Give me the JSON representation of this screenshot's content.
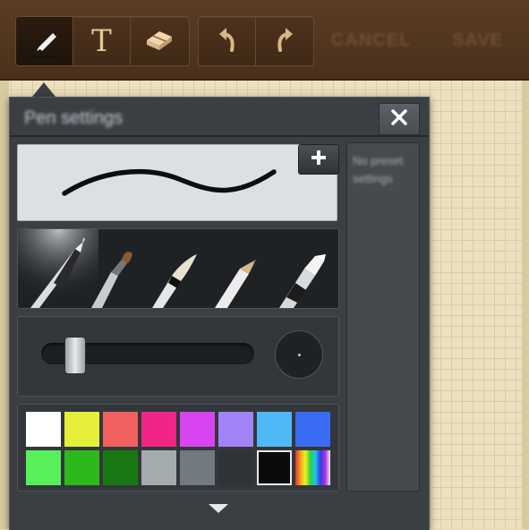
{
  "toolbar": {
    "tools": [
      {
        "name": "pen-tool",
        "icon": "pen-icon",
        "active": true
      },
      {
        "name": "text-tool",
        "icon": "text-icon",
        "glyph": "T",
        "active": false
      },
      {
        "name": "eraser-tool",
        "icon": "eraser-icon",
        "active": false
      }
    ],
    "history": [
      {
        "name": "undo-button",
        "icon": "undo-icon"
      },
      {
        "name": "redo-button",
        "icon": "redo-icon"
      }
    ],
    "cancel_label": "CANCEL",
    "save_label": "SAVE"
  },
  "panel": {
    "title": "Pen settings",
    "close_icon": "close-icon",
    "add_icon": "plus-icon",
    "preset_text": "No preset settings",
    "pens": [
      "marker-pen",
      "brush-pen",
      "calligraphy-brush",
      "pencil",
      "highlighter"
    ],
    "size_level": 0.12,
    "colors": [
      "#ffffff",
      "#e6f03a",
      "#f0605e",
      "#f02585",
      "#d745f0",
      "#a282f7",
      "#4fb8f7",
      "#3a6bf4",
      "#58f05a",
      "#2db81c",
      "#187812",
      "#a4abad",
      "#707a80",
      "#2e3338",
      "#0b0b0b",
      "rainbow"
    ],
    "selected_color": "#0b0b0b"
  }
}
